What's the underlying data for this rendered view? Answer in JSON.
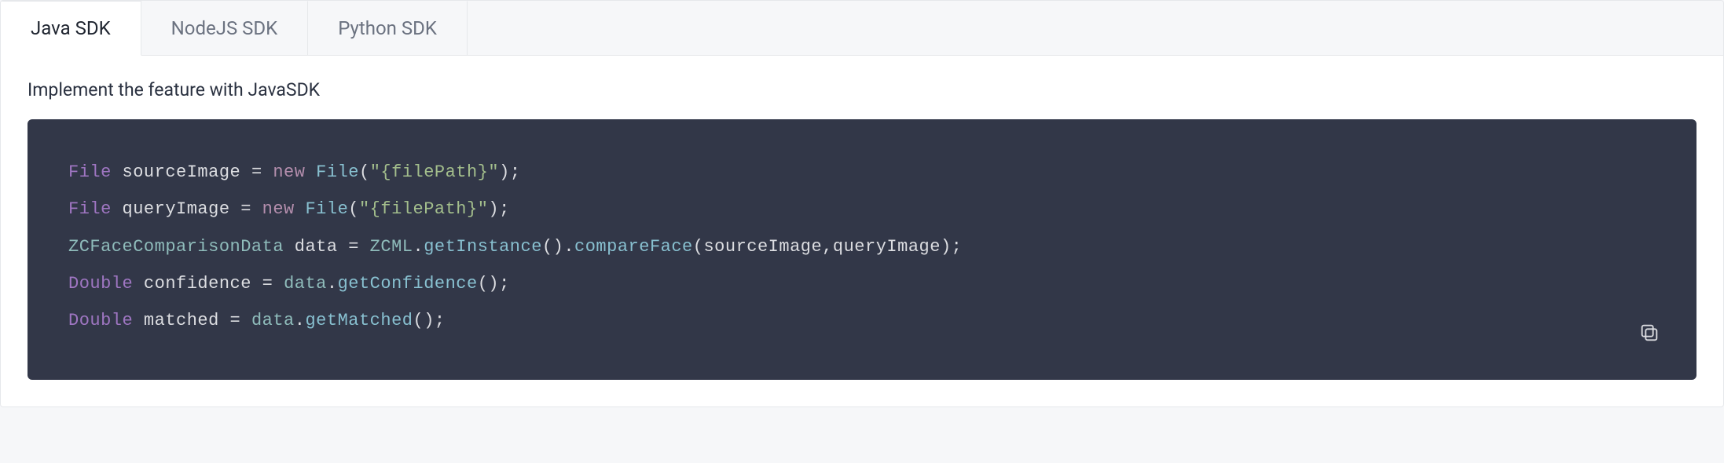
{
  "tabs": [
    {
      "label": "Java SDK",
      "active": true
    },
    {
      "label": "NodeJS SDK",
      "active": false
    },
    {
      "label": "Python SDK",
      "active": false
    }
  ],
  "content": {
    "description": "Implement the feature with JavaSDK",
    "code": {
      "tokens": [
        [
          {
            "t": "type",
            "v": "File"
          },
          {
            "t": "sp",
            "v": " "
          },
          {
            "t": "ident",
            "v": "sourceImage"
          },
          {
            "t": "sp",
            "v": " "
          },
          {
            "t": "op",
            "v": "="
          },
          {
            "t": "sp",
            "v": " "
          },
          {
            "t": "kw",
            "v": "new"
          },
          {
            "t": "sp",
            "v": " "
          },
          {
            "t": "call",
            "v": "File"
          },
          {
            "t": "punc",
            "v": "("
          },
          {
            "t": "str",
            "v": "\"{filePath}\""
          },
          {
            "t": "punc",
            "v": ")"
          },
          {
            "t": "punc",
            "v": ";"
          }
        ],
        [
          {
            "t": "type",
            "v": "File"
          },
          {
            "t": "sp",
            "v": " "
          },
          {
            "t": "ident",
            "v": "queryImage"
          },
          {
            "t": "sp",
            "v": " "
          },
          {
            "t": "op",
            "v": "="
          },
          {
            "t": "sp",
            "v": " "
          },
          {
            "t": "kw",
            "v": "new"
          },
          {
            "t": "sp",
            "v": " "
          },
          {
            "t": "call",
            "v": "File"
          },
          {
            "t": "punc",
            "v": "("
          },
          {
            "t": "str",
            "v": "\"{filePath}\""
          },
          {
            "t": "punc",
            "v": ")"
          },
          {
            "t": "punc",
            "v": ";"
          }
        ],
        [
          {
            "t": "prop",
            "v": "ZCFaceComparisonData"
          },
          {
            "t": "sp",
            "v": " "
          },
          {
            "t": "ident",
            "v": "data"
          },
          {
            "t": "sp",
            "v": " "
          },
          {
            "t": "op",
            "v": "="
          },
          {
            "t": "sp",
            "v": " "
          },
          {
            "t": "prop",
            "v": "ZCML"
          },
          {
            "t": "dot",
            "v": "."
          },
          {
            "t": "call",
            "v": "getInstance"
          },
          {
            "t": "punc",
            "v": "()"
          },
          {
            "t": "dot",
            "v": "."
          },
          {
            "t": "call",
            "v": "compareFace"
          },
          {
            "t": "punc",
            "v": "("
          },
          {
            "t": "ident",
            "v": "sourceImage"
          },
          {
            "t": "punc",
            "v": ","
          },
          {
            "t": "ident",
            "v": "queryImage"
          },
          {
            "t": "punc",
            "v": ")"
          },
          {
            "t": "punc",
            "v": ";"
          }
        ],
        [
          {
            "t": "type",
            "v": "Double"
          },
          {
            "t": "sp",
            "v": " "
          },
          {
            "t": "ident",
            "v": "confidence"
          },
          {
            "t": "sp",
            "v": " "
          },
          {
            "t": "op",
            "v": "="
          },
          {
            "t": "sp",
            "v": " "
          },
          {
            "t": "obj",
            "v": "data"
          },
          {
            "t": "dot",
            "v": "."
          },
          {
            "t": "call",
            "v": "getConfidence"
          },
          {
            "t": "punc",
            "v": "()"
          },
          {
            "t": "punc",
            "v": ";"
          }
        ],
        [
          {
            "t": "type",
            "v": "Double"
          },
          {
            "t": "sp",
            "v": " "
          },
          {
            "t": "ident",
            "v": "matched"
          },
          {
            "t": "sp",
            "v": " "
          },
          {
            "t": "op",
            "v": "="
          },
          {
            "t": "sp",
            "v": " "
          },
          {
            "t": "obj",
            "v": "data"
          },
          {
            "t": "dot",
            "v": "."
          },
          {
            "t": "call",
            "v": "getMatched"
          },
          {
            "t": "punc",
            "v": "()"
          },
          {
            "t": "punc",
            "v": ";"
          }
        ]
      ]
    },
    "copy_label": "Copy code"
  },
  "colors": {
    "bg": "#f6f7f9",
    "code_bg": "#323748",
    "tab_active_text": "#1f2530",
    "tab_inactive_text": "#6b7280"
  }
}
